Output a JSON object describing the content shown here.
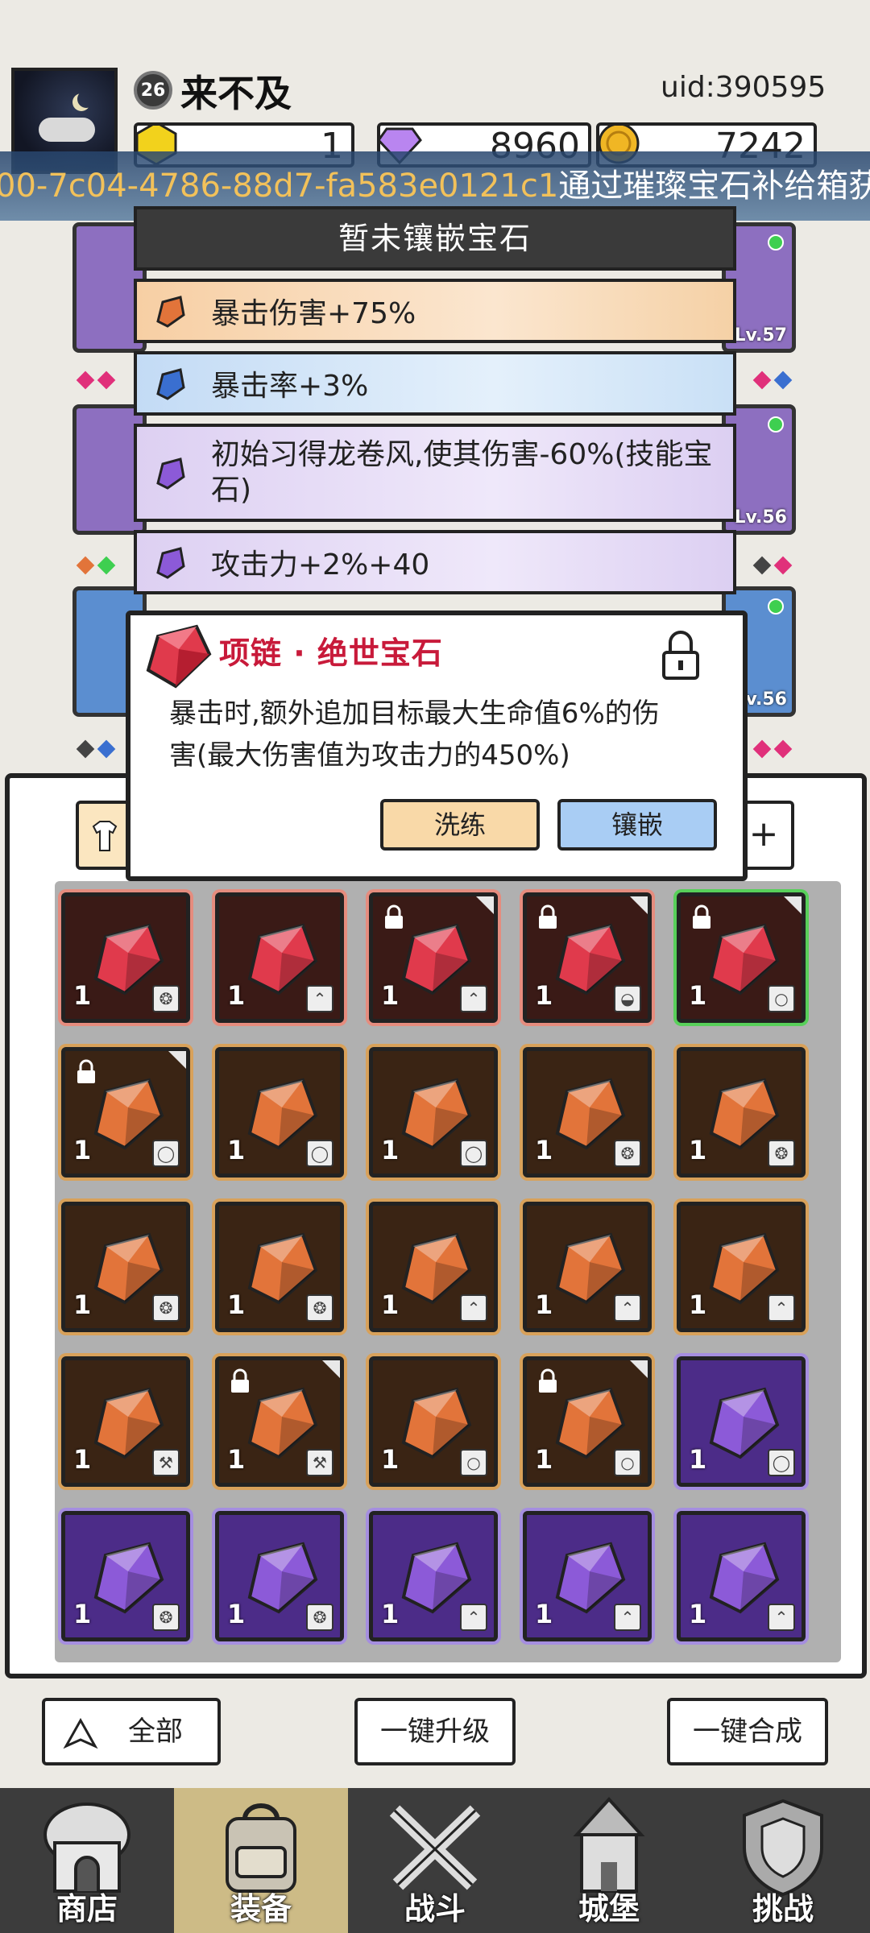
{
  "player": {
    "level": "26",
    "name": "来不及",
    "uid": "uid:390595"
  },
  "resources": {
    "gold_bar": "1",
    "diamond": "8960",
    "coin": "7242"
  },
  "banner": {
    "id_text": "00-7c04-4786-88d7-fa583e0121c1",
    "message": "通过璀璨宝石补给箱获"
  },
  "equipment_levels": [
    "Lv.57",
    "Lv.56",
    "Lv.56"
  ],
  "gem_stats": {
    "title": "暂未镶嵌宝石",
    "rows": [
      {
        "text": "暴击伤害+75%",
        "color": "orange"
      },
      {
        "text": "暴击率+3%",
        "color": "blue"
      },
      {
        "text": "初始习得龙卷风,使其伤害-60%(技能宝石)",
        "color": "purple"
      },
      {
        "text": "攻击力+2%+40",
        "color": "purple"
      }
    ]
  },
  "gem_detail": {
    "title": "项链 · 绝世宝石",
    "description": "暴击时,额外追加目标最大生命值6%的伤害(最大伤害值为攻击力的450%)",
    "wash_label": "洗练",
    "inlay_label": "镶嵌"
  },
  "gem_grid": [
    {
      "color": "red",
      "qty": "1",
      "locked": false,
      "part": "armor-icon"
    },
    {
      "color": "red",
      "qty": "1",
      "locked": false,
      "part": "boot-icon"
    },
    {
      "color": "red",
      "qty": "1",
      "locked": true,
      "part": "boot-icon"
    },
    {
      "color": "red",
      "qty": "1",
      "locked": true,
      "part": "helmet-icon"
    },
    {
      "color": "red",
      "qty": "1",
      "locked": true,
      "part": "necklace-icon",
      "selected": true
    },
    {
      "color": "orange",
      "qty": "1",
      "locked": true,
      "part": "ring-icon"
    },
    {
      "color": "orange",
      "qty": "1",
      "locked": false,
      "part": "ring-icon"
    },
    {
      "color": "orange",
      "qty": "1",
      "locked": false,
      "part": "ring-icon"
    },
    {
      "color": "orange",
      "qty": "1",
      "locked": false,
      "part": "armor-icon"
    },
    {
      "color": "orange",
      "qty": "1",
      "locked": false,
      "part": "armor-icon"
    },
    {
      "color": "orange",
      "qty": "1",
      "locked": false,
      "part": "armor-icon"
    },
    {
      "color": "orange",
      "qty": "1",
      "locked": false,
      "part": "armor-icon"
    },
    {
      "color": "orange",
      "qty": "1",
      "locked": false,
      "part": "boot-icon"
    },
    {
      "color": "orange",
      "qty": "1",
      "locked": false,
      "part": "boot-icon"
    },
    {
      "color": "orange",
      "qty": "1",
      "locked": false,
      "part": "boot-icon"
    },
    {
      "color": "orange",
      "qty": "1",
      "locked": false,
      "part": "weapon-icon"
    },
    {
      "color": "orange",
      "qty": "1",
      "locked": true,
      "part": "weapon-icon"
    },
    {
      "color": "orange",
      "qty": "1",
      "locked": false,
      "part": "necklace-icon"
    },
    {
      "color": "orange",
      "qty": "1",
      "locked": true,
      "part": "necklace-icon"
    },
    {
      "color": "purple",
      "qty": "1",
      "locked": false,
      "part": "ring-icon"
    },
    {
      "color": "purple",
      "qty": "1",
      "locked": false,
      "part": "armor-icon"
    },
    {
      "color": "purple",
      "qty": "1",
      "locked": false,
      "part": "armor-icon"
    },
    {
      "color": "purple",
      "qty": "1",
      "locked": false,
      "part": "boot-icon"
    },
    {
      "color": "purple",
      "qty": "1",
      "locked": false,
      "part": "boot-icon"
    },
    {
      "color": "purple",
      "qty": "1",
      "locked": false,
      "part": "boot-icon"
    }
  ],
  "actions": {
    "filter_label": "全部",
    "upgrade_label": "一键升级",
    "merge_label": "一键合成"
  },
  "nav": [
    {
      "label": "商店",
      "icon": "shop-icon",
      "active": false
    },
    {
      "label": "装备",
      "icon": "backpack-icon",
      "active": true
    },
    {
      "label": "战斗",
      "icon": "crossed-swords-icon",
      "active": false
    },
    {
      "label": "城堡",
      "icon": "castle-icon",
      "active": false
    },
    {
      "label": "挑战",
      "icon": "shield-challenge-icon",
      "active": false
    }
  ],
  "colors": {
    "red_gem": "#e03a4c",
    "orange_gem": "#e2743a",
    "purple_gem": "#8c5ad8",
    "blue_gem": "#3a6fd0",
    "title_red": "#c81a3a"
  }
}
